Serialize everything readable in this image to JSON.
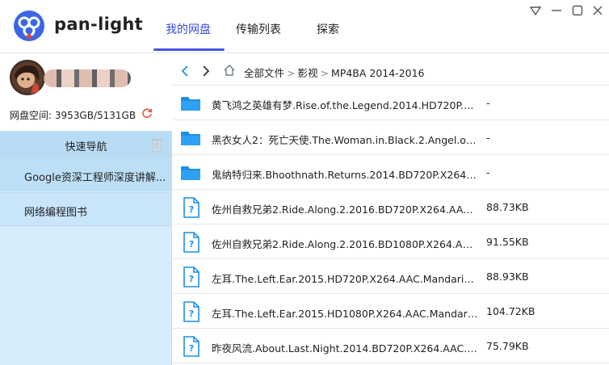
{
  "app": {
    "name": "pan-light"
  },
  "nav": {
    "tabs": [
      {
        "label": "我的网盘",
        "active": true
      },
      {
        "label": "传输列表",
        "active": false
      },
      {
        "label": "探索",
        "active": false
      }
    ]
  },
  "window_controls": [
    "dropdown-icon",
    "minimize-icon",
    "maximize-icon",
    "close-icon"
  ],
  "sidebar": {
    "quota_label": "网盘空间:",
    "quota_value": "3953GB/5131GB",
    "quick_nav_label": "快速导航",
    "bookmarks": [
      {
        "label": "Google资深工程师深度讲解..."
      },
      {
        "label": "网络编程图书"
      }
    ]
  },
  "breadcrumb": {
    "items": [
      "全部文件",
      "影视",
      "MP4BA 2014-2016"
    ],
    "separator": ">"
  },
  "files": [
    {
      "type": "folder",
      "name": "黄飞鸿之英雄有梦.Rise.of.the.Legend.2014.HD720P.X...",
      "size": "-"
    },
    {
      "type": "folder",
      "name": "黑衣女人2：死亡天使.The.Woman.in.Black.2.Angel.of....",
      "size": "-"
    },
    {
      "type": "folder",
      "name": "鬼纳特归来.Bhoothnath.Returns.2014.BD720P.X264....",
      "size": "-"
    },
    {
      "type": "file",
      "name": "佐州自救兄弟2.Ride.Along.2.2016.BD720P.X264.AAC....",
      "size": "88.73KB"
    },
    {
      "type": "file",
      "name": "佐州自救兄弟2.Ride.Along.2.2016.BD1080P.X264.AA...",
      "size": "91.55KB"
    },
    {
      "type": "file",
      "name": "左耳.The.Left.Ear.2015.HD720P.X264.AAC.Mandarin....",
      "size": "88.93KB"
    },
    {
      "type": "file",
      "name": "左耳.The.Left.Ear.2015.HD1080P.X264.AAC.Mandarin...",
      "size": "104.72KB"
    },
    {
      "type": "file",
      "name": "昨夜风流.About.Last.Night.2014.BD720P.X264.AAC.e...",
      "size": "75.79KB"
    }
  ],
  "colors": {
    "accent": "#3b4fd8",
    "sidebar_bg": "#d7ecfb",
    "folder": "#1f8fe6",
    "file_icon": "#1f8fe6"
  }
}
